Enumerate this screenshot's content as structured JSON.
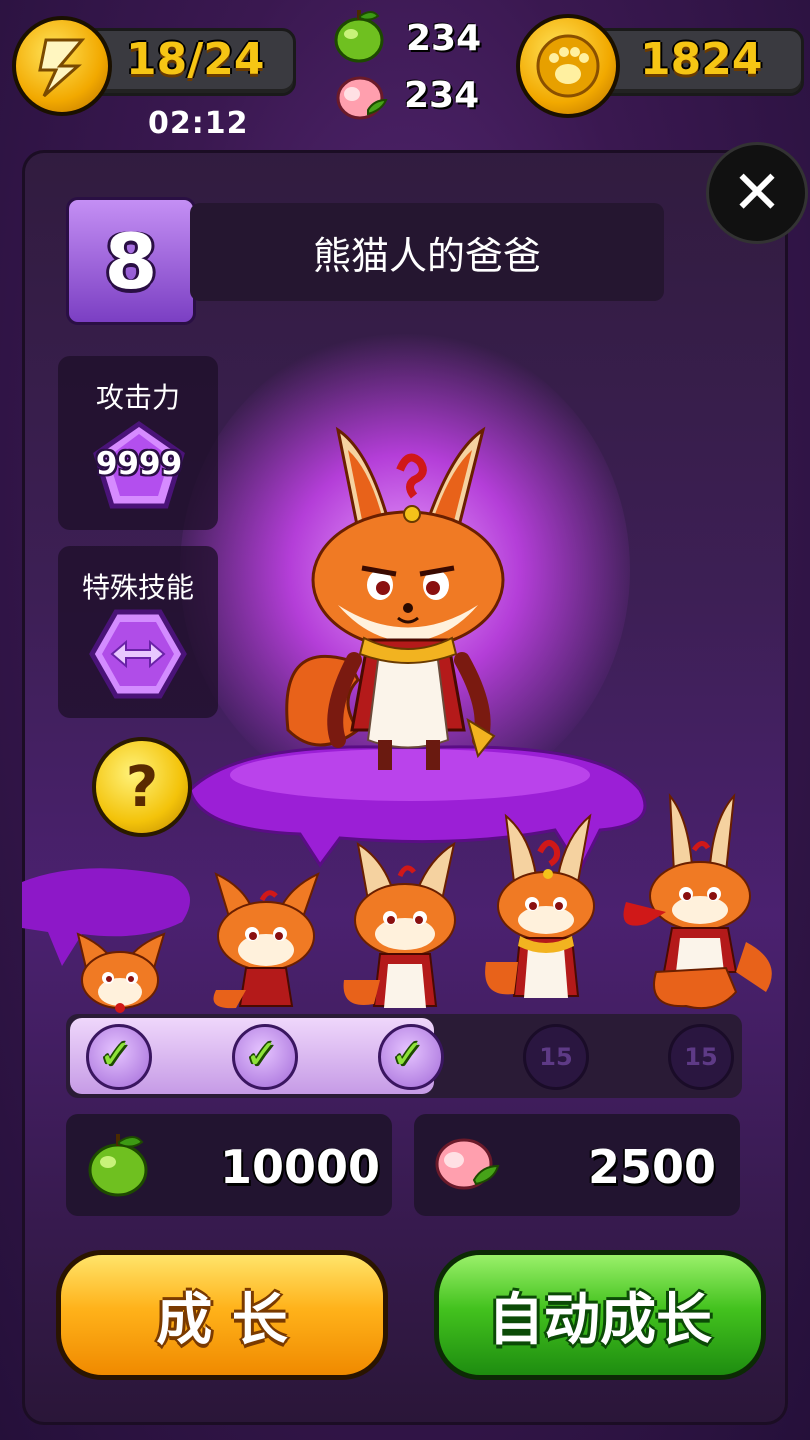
{
  "hud": {
    "energy": "18/24",
    "timer": "02:12",
    "apples": "234",
    "peaches": "234",
    "coins": "1824"
  },
  "pet": {
    "level": "8",
    "name": "熊猫人的爸爸"
  },
  "stats": {
    "attack_label": "攻击力",
    "attack_value": "9999",
    "skill_label": "特殊技能"
  },
  "evolution": {
    "stages_completed": 3,
    "stages_total": 5,
    "locked_level_1": "15",
    "locked_level_2": "15"
  },
  "cost": {
    "apple_cost": "10000",
    "peach_cost": "2500"
  },
  "buttons": {
    "grow": "成 长",
    "auto_grow": "自动成长"
  },
  "icons": {
    "close": "✕",
    "help": "?",
    "check": "✓"
  }
}
